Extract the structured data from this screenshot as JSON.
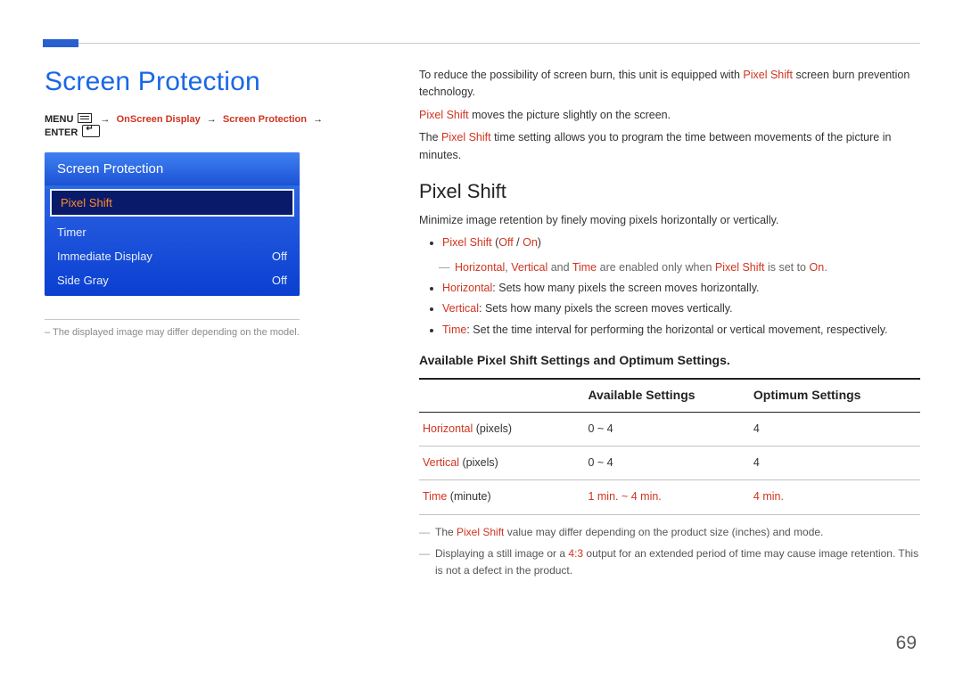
{
  "page_number": "69",
  "title": "Screen Protection",
  "breadcrumb": {
    "menu_label": "MENU",
    "path1": "OnScreen Display",
    "path2": "Screen Protection",
    "enter_label": "ENTER"
  },
  "osd": {
    "header": "Screen Protection",
    "rows": [
      {
        "label": "Pixel Shift",
        "value": "",
        "selected": true
      },
      {
        "label": "Timer",
        "value": "",
        "selected": false
      },
      {
        "label": "Immediate Display",
        "value": "Off",
        "selected": false
      },
      {
        "label": "Side Gray",
        "value": "Off",
        "selected": false
      }
    ]
  },
  "caption_note_prefix": "– ",
  "caption_note": "The displayed image may differ depending on the model.",
  "intro": {
    "line1a": "To reduce the possibility of screen burn, this unit is equipped with ",
    "line1b_red": "Pixel Shift",
    "line1c": " screen burn prevention technology.",
    "line2a_red": "Pixel Shift",
    "line2b": " moves the picture slightly on the screen.",
    "line3a": "The ",
    "line3b_red": "Pixel Shift",
    "line3c": " time setting allows you to program the time between movements of the picture in minutes."
  },
  "section_heading": "Pixel Shift",
  "section_lead": "Minimize image retention by finely moving pixels horizontally or vertically.",
  "bullet1": {
    "red": "Pixel Shift",
    "paren_open": " (",
    "red2": "Off",
    "sep": " / ",
    "red3": "On",
    "paren_close": ")"
  },
  "subnote": {
    "h_red": "Horizontal",
    "v_red": "Vertical",
    "and_txt": " and ",
    "t_red": "Time",
    "txt_a": " are enabled only when ",
    "ps_red": "Pixel Shift",
    "txt_b": " is set to ",
    "on_red": "On",
    "dot": "."
  },
  "sub_bullets": [
    {
      "label_red": "Horizontal",
      "text": ": Sets how many pixels the screen moves horizontally."
    },
    {
      "label_red": "Vertical",
      "text": ": Sets how many pixels the screen moves vertically."
    },
    {
      "label_red": "Time",
      "text": ": Set the time interval for performing the horizontal or vertical movement, respectively."
    }
  ],
  "table_title": "Available Pixel Shift Settings and Optimum Settings.",
  "chart_data": {
    "type": "table",
    "columns": [
      "",
      "Available Settings",
      "Optimum Settings"
    ],
    "rows": [
      {
        "name_red": "Horizontal",
        "name_suffix": " (pixels)",
        "available": "0 ~ 4",
        "available_is_red": false,
        "optimum": "4",
        "optimum_is_red": false
      },
      {
        "name_red": "Vertical",
        "name_suffix": " (pixels)",
        "available": "0 ~ 4",
        "available_is_red": false,
        "optimum": "4",
        "optimum_is_red": false
      },
      {
        "name_red": "Time",
        "name_suffix": " (minute)",
        "available": "1 min. ~ 4 min.",
        "available_is_red": true,
        "optimum": "4 min.",
        "optimum_is_red": true
      }
    ]
  },
  "foot_notes": {
    "n1a": "The ",
    "n1b_red": "Pixel Shift",
    "n1c": " value may differ depending on the product size (inches) and mode.",
    "n2a": "Displaying a still image or a ",
    "n2b_red": "4:3",
    "n2c": " output for an extended period of time may cause image retention. This is not a defect in the product."
  }
}
